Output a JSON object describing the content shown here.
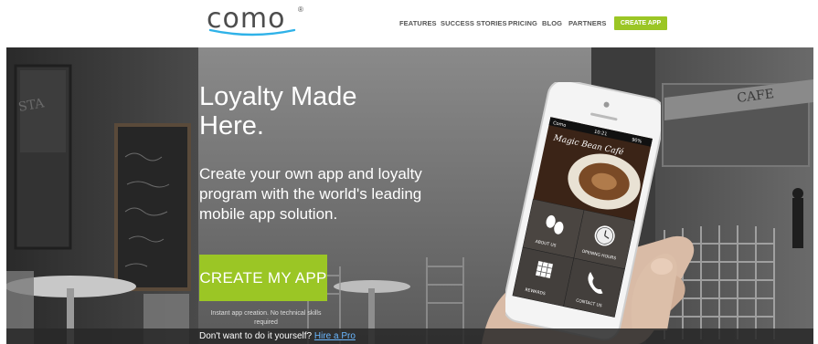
{
  "header": {
    "logo_text": "como",
    "logo_mark": "®",
    "nav": [
      {
        "label": "FEATURES"
      },
      {
        "label": "SUCCESS STORIES"
      },
      {
        "label": "PRICING"
      },
      {
        "label": "BLOG"
      },
      {
        "label": "PARTNERS"
      }
    ],
    "cta_label": "CREATE APP"
  },
  "hero": {
    "title": "Loyalty Made Here.",
    "subtitle": "Create your own app and loyalty program with the world's leading mobile app solution.",
    "cta_label": "CREATE MY APP",
    "cta_note": "Instant app creation. No technical skills required",
    "bottom_text": "Don't want to do it yourself?",
    "bottom_link": "Hire a Pro"
  },
  "phone": {
    "carrier": "Como",
    "time": "10:21",
    "battery": "90%",
    "app_name": "Magic Bean Café",
    "tiles": [
      {
        "label": "ABOUT US",
        "icon": "coffee-beans-icon"
      },
      {
        "label": "OPENING HOURS",
        "icon": "clock-icon"
      },
      {
        "label": "REWARDS",
        "icon": "grid-card-icon"
      },
      {
        "label": "CONTACT US",
        "icon": "phone-icon"
      }
    ]
  },
  "scene_sign": "CAFE",
  "colors": {
    "accent": "#9bc625",
    "link": "#6ab7ff",
    "nav_text": "#555555"
  }
}
